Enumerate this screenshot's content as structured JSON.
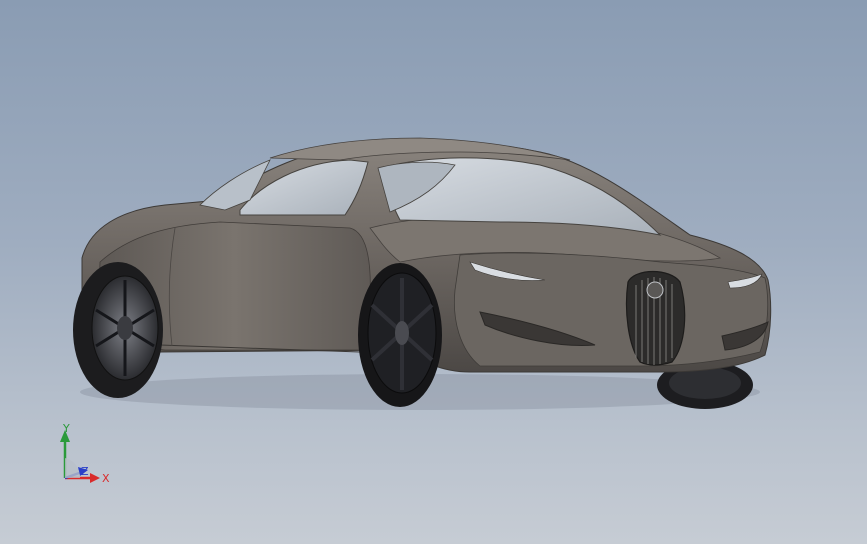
{
  "viewport": {
    "background_top": "#8a9cb3",
    "background_bottom": "#c6ccd4",
    "model_color": "#6e6863",
    "model_shadow": "#4a4642",
    "glass_color": "#c7ced6",
    "tire_color": "#1c1c1e"
  },
  "triad": {
    "x_label": "X",
    "y_label": "Y",
    "z_label": "Z",
    "x_color": "#d92b2b",
    "y_color": "#2a9a3a",
    "z_color": "#2a3fc9"
  }
}
